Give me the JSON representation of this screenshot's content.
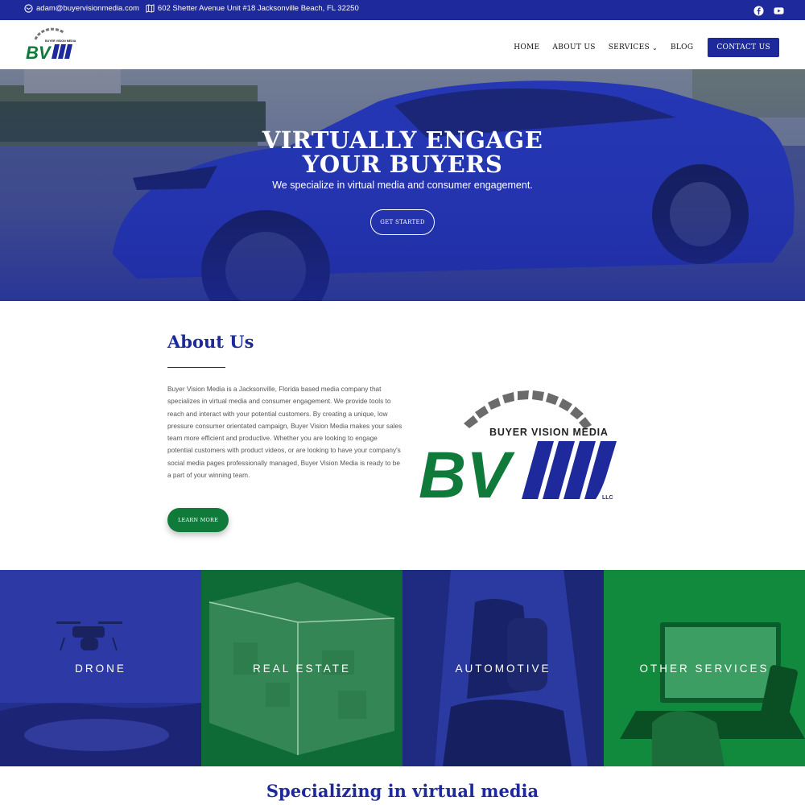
{
  "topbar": {
    "email": "adam@buyervisionmedia.com",
    "address": "602 Shetter Avenue Unit #18 Jacksonville Beach, FL 32250",
    "social": [
      "facebook-icon",
      "youtube-icon"
    ]
  },
  "header": {
    "logo_text": "BV",
    "logo_subtext": "BUYER VISION MEDIA",
    "nav": {
      "home": "HOME",
      "about": "ABOUT US",
      "services": "SERVICES",
      "blog": "BLOG",
      "contact": "CONTACT US"
    }
  },
  "hero": {
    "title_line1": "VIRTUALLY ENGAGE",
    "title_line2": "YOUR BUYERS",
    "subtitle": "We specialize in virtual media and consumer engagement.",
    "cta": "GET STARTED"
  },
  "about": {
    "title": "About Us",
    "text": "Buyer Vision Media is a Jacksonville, Florida based media company that specializes in virtual media and consumer engagement. We provide tools to reach and interact with your potential customers. By creating a unique, low pressure consumer orientated campaign, Buyer Vision Media makes your sales team more efficient and productive. Whether you are looking to engage potential customers with product videos, or are looking to have your company's social media pages professionally managed, Buyer Vision Media is ready to be a part of your winning team.",
    "button": "LEARN MORE",
    "logo_brand": "BUYER VISION MEDIA",
    "logo_letters": "BV",
    "logo_llc": "LLC"
  },
  "tiles": [
    {
      "label": "DRONE",
      "color": "#2d3aa5"
    },
    {
      "label": "REAL ESTATE",
      "color": "#0f6b35"
    },
    {
      "label": "AUTOMOTIVE",
      "color": "#2a3aa0"
    },
    {
      "label": "OTHER SERVICES",
      "color": "#118a3d"
    }
  ],
  "section": {
    "title": "Specializing in virtual media"
  },
  "colors": {
    "brand_blue": "#1e2a9c",
    "brand_green": "#0f7a3a"
  }
}
